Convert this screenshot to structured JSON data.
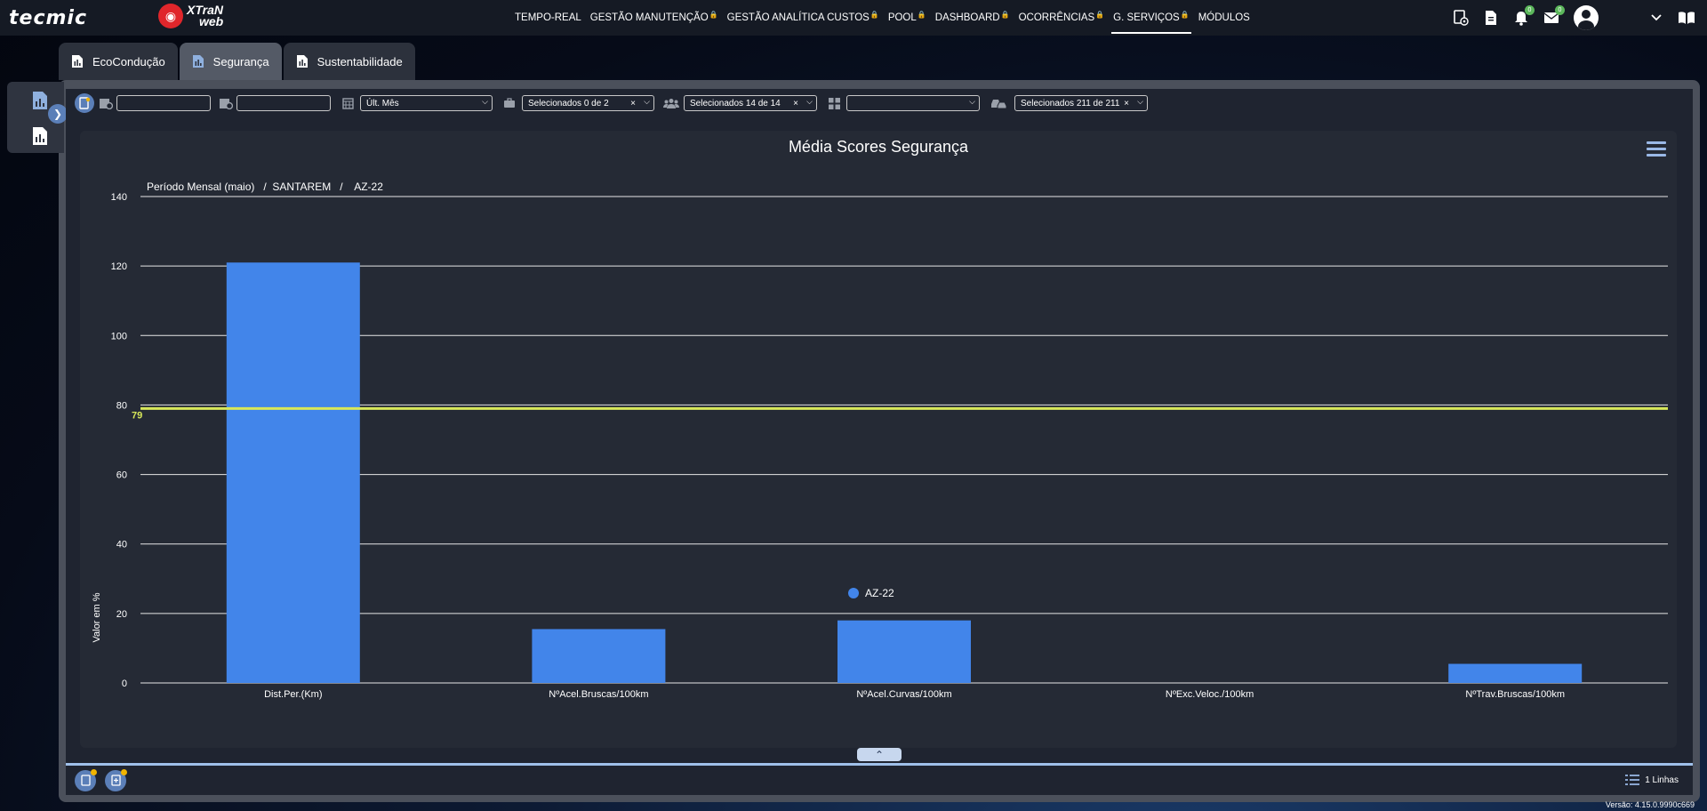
{
  "brand": {
    "tecmic": "tecmic",
    "xtran": "XTraN",
    "web": "web"
  },
  "nav": [
    {
      "label": "TEMPO-REAL",
      "locked": false,
      "active": false
    },
    {
      "label": "GESTÃO MANUTENÇÃO",
      "locked": true,
      "active": false
    },
    {
      "label": "GESTÃO ANALÍTICA CUSTOS",
      "locked": true,
      "active": false
    },
    {
      "label": "POOL",
      "locked": true,
      "active": false
    },
    {
      "label": "DASHBOARD",
      "locked": true,
      "active": false
    },
    {
      "label": "OCORRÊNCIAS",
      "locked": true,
      "active": false
    },
    {
      "label": "G. SERVIÇOS",
      "locked": true,
      "active": true
    },
    {
      "label": "MÓDULOS",
      "locked": false,
      "active": false
    }
  ],
  "notifications": {
    "bell_count": "0",
    "mail_count": "0"
  },
  "tabs": [
    {
      "label": "EcoCondução",
      "active": false
    },
    {
      "label": "Segurança",
      "active": true
    },
    {
      "label": "Sustentabilidade",
      "active": false
    }
  ],
  "filters": {
    "date_from": "",
    "date_to": "",
    "period": "Últ. Mês",
    "clients": "Selecionados 0 de 2",
    "groups": "Selecionados 14 de 14",
    "category": "",
    "vehicles": "Selecionados 211 de 211"
  },
  "breadcrumb": {
    "period": "Período Mensal (maio)",
    "location": "SANTAREM",
    "vehicle": "AZ-22"
  },
  "chart_data": {
    "type": "bar",
    "title": "Média Scores Segurança",
    "ylabel": "Valor em %",
    "xlabel": "",
    "ylim": [
      0,
      140
    ],
    "yticks": [
      0,
      20,
      40,
      60,
      80,
      100,
      120,
      140
    ],
    "categories": [
      "Dist.Per.(Km)",
      "NºAcel.Bruscas/100km",
      "NºAcel.Curvas/100km",
      "NºExc.Veloc./100km",
      "NºTrav.Bruscas/100km"
    ],
    "series": [
      {
        "name": "AZ-22",
        "values": [
          121,
          15.5,
          18,
          0,
          5.5
        ]
      }
    ],
    "reference_line": {
      "value": 79,
      "label": "79",
      "color": "#d8e85a"
    },
    "bar_color": "#4285ea",
    "grid": true,
    "legend": "bottom-center"
  },
  "footer": {
    "lines_label": "1 Linhas"
  },
  "version": "Versão: 4.15.0.9990c669"
}
